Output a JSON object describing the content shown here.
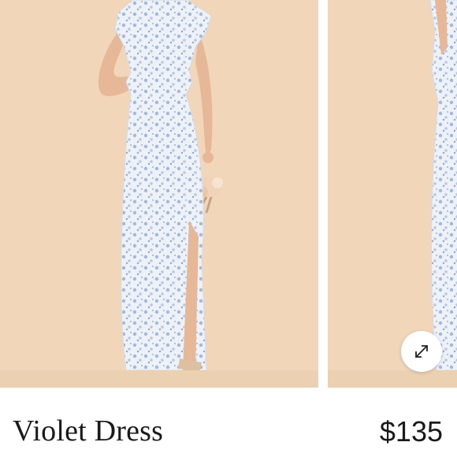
{
  "gallery": {
    "background_color": "#f1d6b9",
    "dress_color": "#c9d9ee",
    "expand_icon": "expand-diagonal-arrows-icon",
    "current_index": 1
  },
  "product": {
    "name": "Violet Dress",
    "price": "$135"
  }
}
